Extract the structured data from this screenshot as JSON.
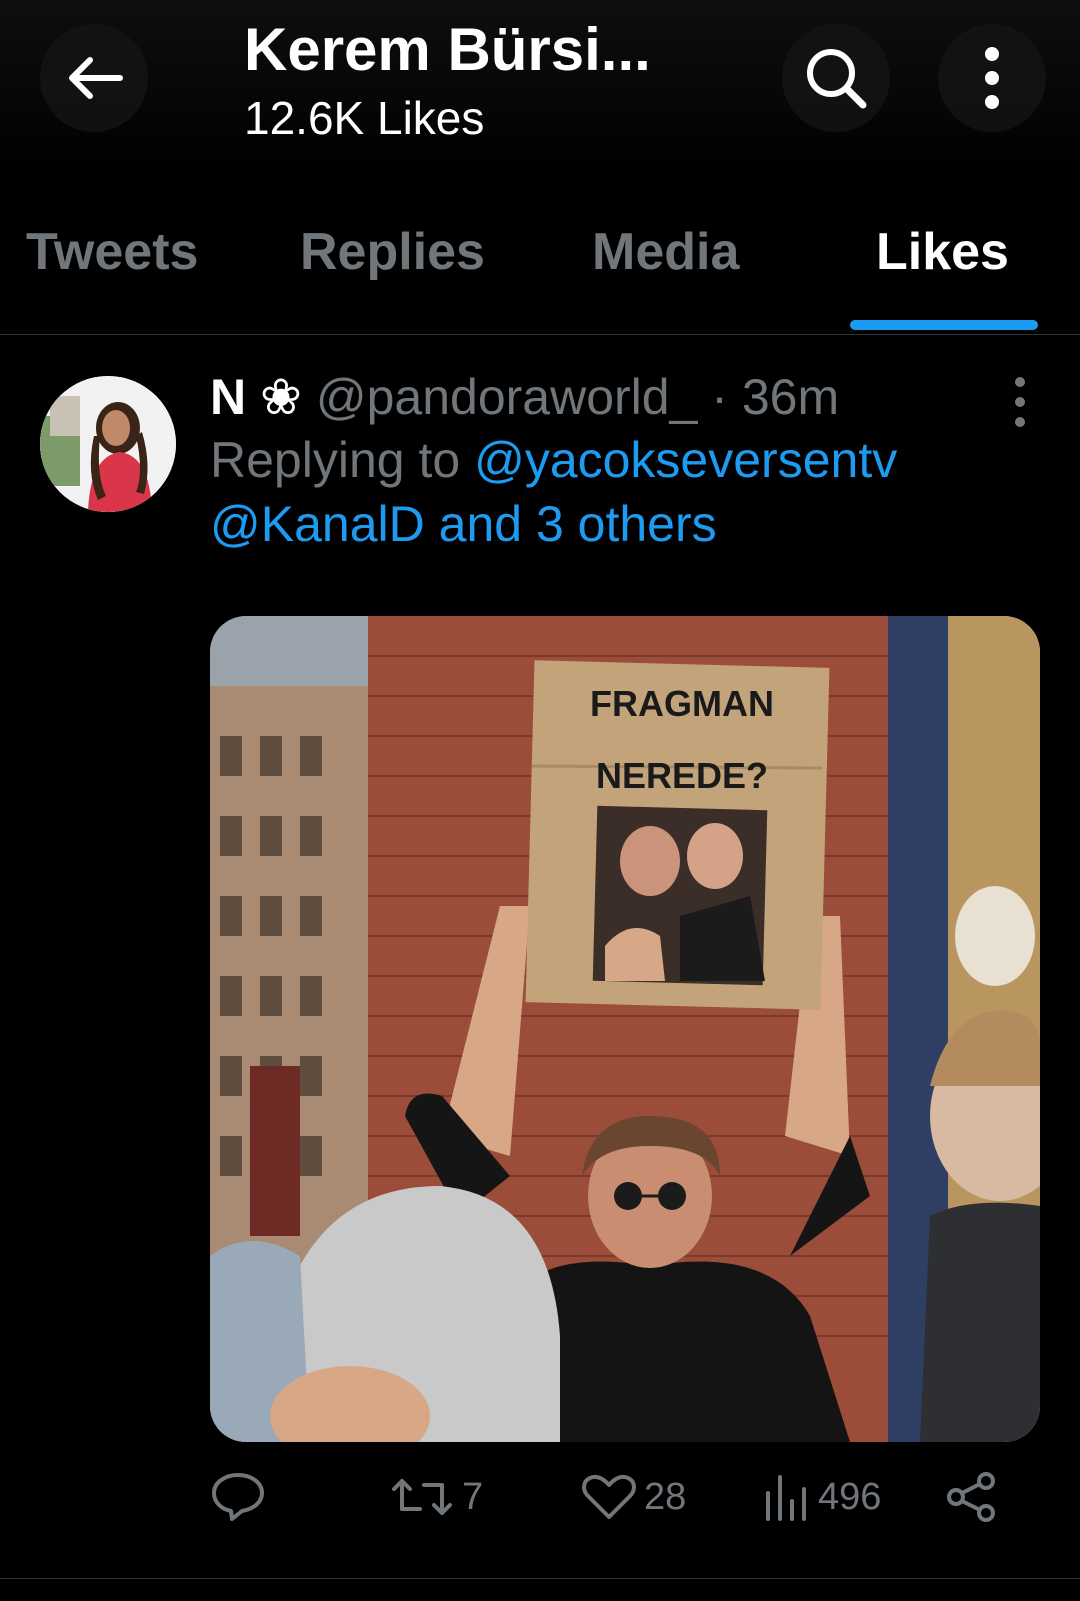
{
  "header": {
    "title": "Kerem Bürsi...",
    "subtitle": "12.6K Likes",
    "back_icon": "arrow-left-icon",
    "search_icon": "search-icon",
    "more_icon": "more-vertical-icon"
  },
  "tabs": [
    {
      "label": "Tweets",
      "active": false
    },
    {
      "label": "Replies",
      "active": false
    },
    {
      "label": "Media",
      "active": false
    },
    {
      "label": "Likes",
      "active": true
    }
  ],
  "tweet": {
    "display_name": "N",
    "name_glyph": "❀",
    "handle": "@pandoraworld_",
    "time": "· 36m",
    "replying_prefix": "Replying to",
    "mention1": "@yacokseversentv",
    "mention2": "@KanalD and 3 others",
    "image": {
      "sign_line1": "FRAGMAN",
      "sign_line2": "NEREDE?"
    },
    "actions": {
      "reply_count": "",
      "retweet_count": "7",
      "like_count": "28",
      "views_count": "496"
    }
  },
  "colors": {
    "background": "#000000",
    "accent": "#1d9bf0",
    "muted": "#71767b",
    "text": "#e7e9ea"
  }
}
